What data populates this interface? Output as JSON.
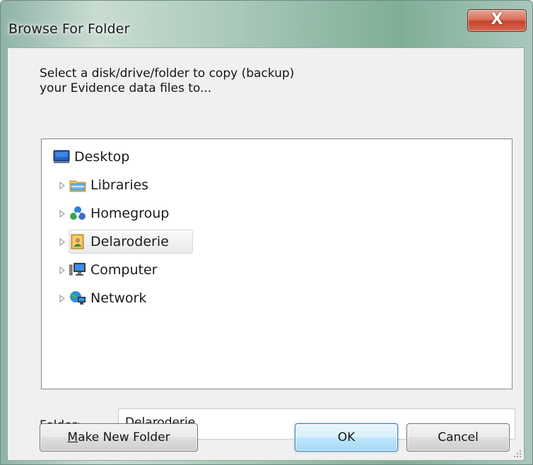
{
  "window": {
    "title": "Browse For Folder",
    "close_label": "X"
  },
  "prompt": {
    "line1": "Select a disk/drive/folder to copy (backup)",
    "line2": "your Evidence data files to..."
  },
  "tree": {
    "items": [
      {
        "label": "Desktop",
        "icon": "desktop-icon",
        "expander": false,
        "selected": false
      },
      {
        "label": "Libraries",
        "icon": "libraries-icon",
        "expander": true,
        "selected": false
      },
      {
        "label": "Homegroup",
        "icon": "homegroup-icon",
        "expander": true,
        "selected": false
      },
      {
        "label": "Delaroderie",
        "icon": "user-folder-icon",
        "expander": true,
        "selected": true
      },
      {
        "label": "Computer",
        "icon": "computer-icon",
        "expander": true,
        "selected": false
      },
      {
        "label": "Network",
        "icon": "network-icon",
        "expander": true,
        "selected": false
      }
    ]
  },
  "folder": {
    "label_prefix": "",
    "label_accel": "F",
    "label_rest": "older:",
    "value": "Delaroderie"
  },
  "buttons": {
    "make_new_folder_accel": "M",
    "make_new_folder_rest": "ake New Folder",
    "ok": "OK",
    "cancel": "Cancel"
  },
  "colors": {
    "selection_bg": "#ebebeb",
    "default_button_border": "#3c7fb1",
    "close_button": "#c5432b"
  }
}
